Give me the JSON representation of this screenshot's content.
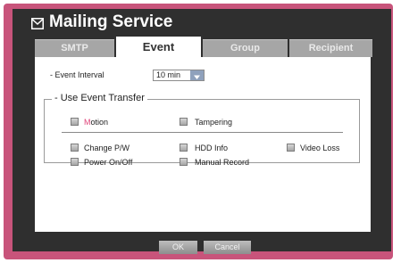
{
  "window": {
    "title": "Mailing Service"
  },
  "tabs": [
    {
      "label": "SMTP",
      "active": false
    },
    {
      "label": "Event",
      "active": true
    },
    {
      "label": "Group",
      "active": false
    },
    {
      "label": "Recipient",
      "active": false
    }
  ],
  "event_interval": {
    "label": "- Event Interval",
    "value": "10 min"
  },
  "event_transfer": {
    "legend": "- Use Event Transfer",
    "motion": {
      "first": "M",
      "rest": "otion",
      "checked": false
    },
    "tampering": {
      "label": "Tampering",
      "checked": false
    },
    "change_pw": {
      "label": "Change P/W",
      "checked": false
    },
    "hdd_info": {
      "label": "HDD Info",
      "checked": false
    },
    "video_loss": {
      "label": "Video Loss",
      "checked": false
    },
    "power_onoff": {
      "label": "Power On/Off",
      "checked": false
    },
    "manual_record": {
      "label": "Manual Record",
      "checked": false
    }
  },
  "footer": {
    "ok_label": "OK",
    "cancel_label": "Cancel"
  },
  "colors": {
    "accent": "#c8547b",
    "motion_highlight": "#e0457a",
    "active_tab": "#ffffff",
    "inactive_tab": "#a6a6a6"
  }
}
